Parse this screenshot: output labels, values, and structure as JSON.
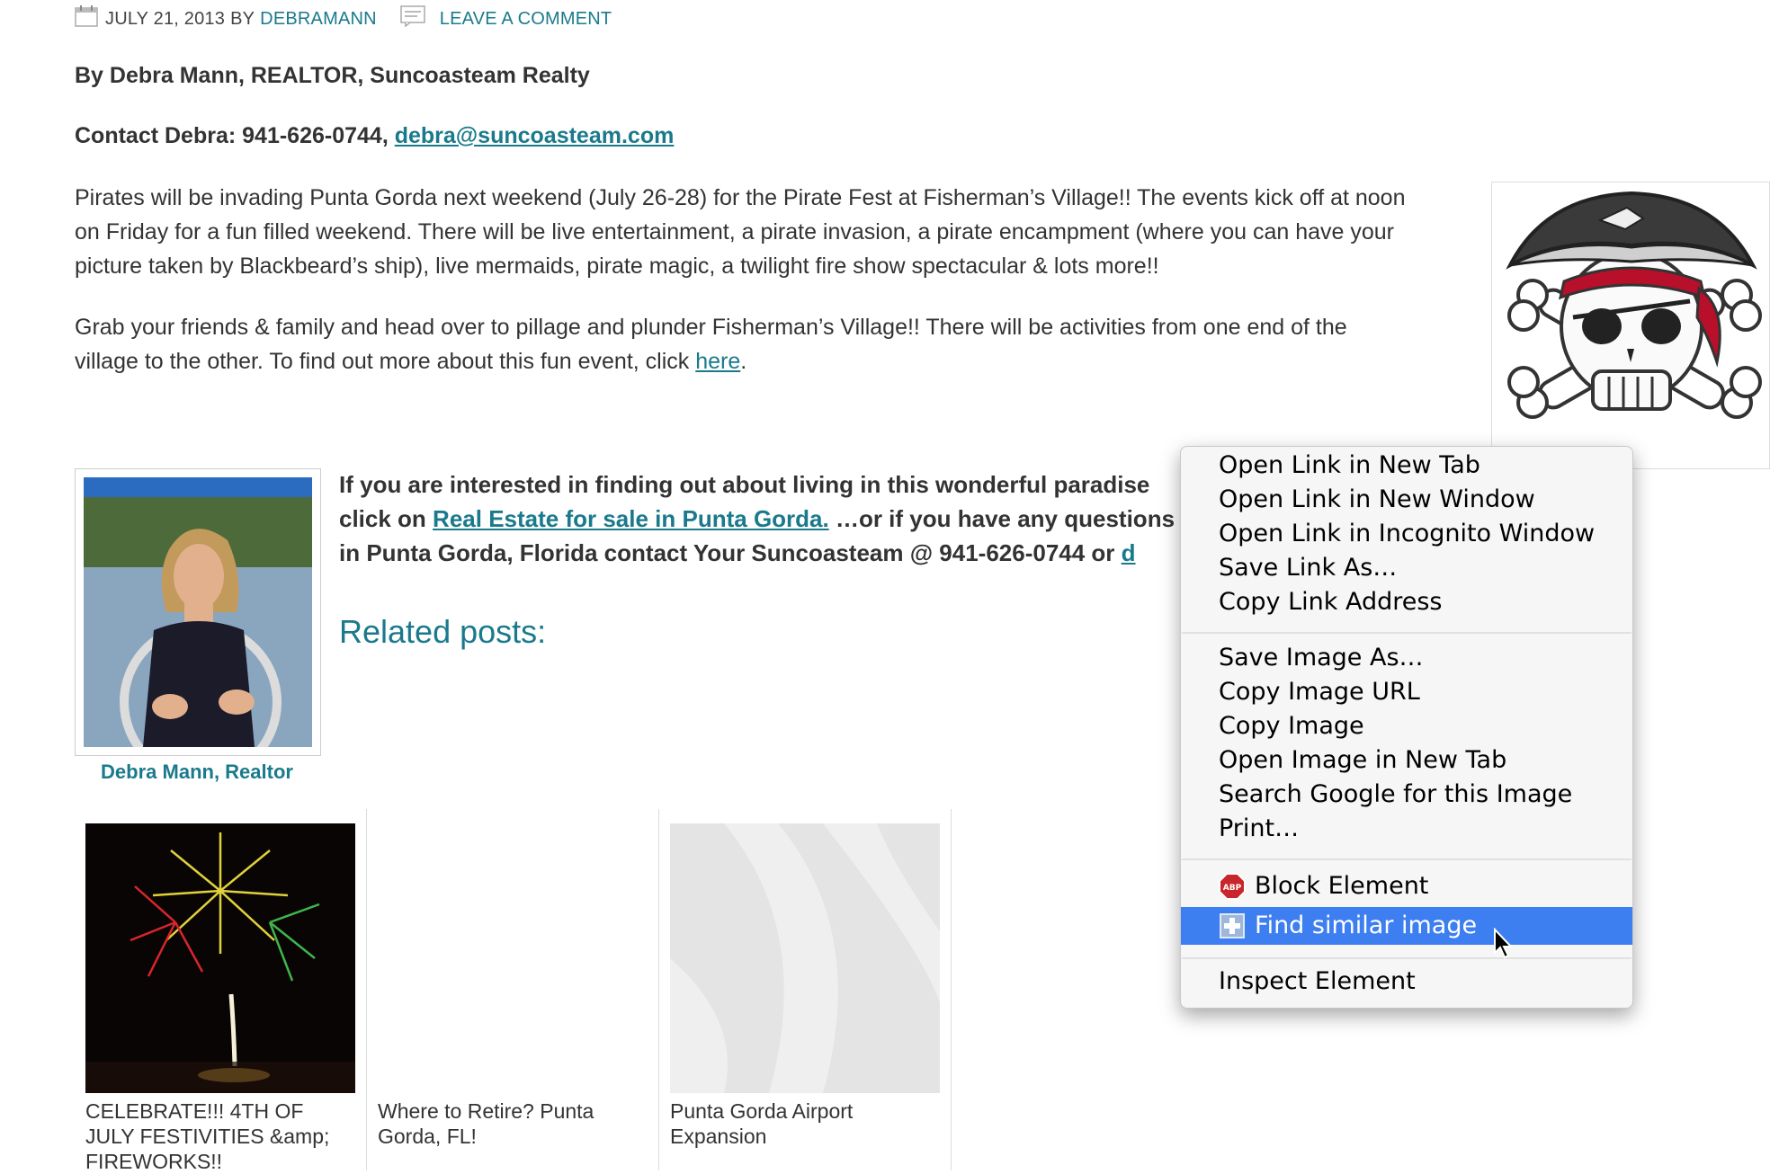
{
  "post_meta": {
    "date": "JULY 21, 2013",
    "by": "BY",
    "author": "DEBRAMANN",
    "comment_link": "LEAVE A COMMENT"
  },
  "byline": "By Debra Mann, REALTOR, Suncoasteam Realty",
  "contact": {
    "prefix": "Contact Debra: 941-626-0744, ",
    "email": "debra@suncoasteam.com"
  },
  "paragraphs": {
    "p1_line1": "Pirates will be invading Punta Gorda next weekend (July 26-28) for the Pirate Fest at Fisherman’s Village!!  The events kick off at noon",
    "p1_line2": "on Friday for a fun filled weekend.  There will be live entertainment, a pirate invasion, a pirate encampment (where you can have your",
    "p1_line3": "picture taken by Blackbeard’s ship), live mermaids, pirate magic, a twilight fire show spectacular & lots more!!",
    "p2_line1": "Grab your friends & family and head over to pillage and plunder Fisherman’s Village!!  There will be activities from one end of the",
    "p2_line2_prefix": "village to the other.  To find out more about this fun event, click ",
    "p2_link": "here",
    "p2_suffix": "."
  },
  "interest": {
    "line1": "If you are interested in finding out about living in this wonderful paradise",
    "line2_prefix": "click on ",
    "line2_link": "Real Estate for sale in Punta Gorda.",
    "line2_suffix": "  …or if you have any questions about real estate",
    "line3": "in Punta Gorda, Florida contact Your Suncoasteam @ 941-626-0744 or ",
    "line3_link": "d"
  },
  "author_caption": "Debra Mann, Realtor",
  "related_heading": "Related posts:",
  "related_posts": [
    {
      "title": "CELEBRATE!!! 4TH OF JULY FESTIVITIES &amp; FIREWORKS!!"
    },
    {
      "title": "Where to Retire? Punta Gorda, FL!"
    },
    {
      "title": "Punta Gorda Airport Expansion"
    }
  ],
  "context_menu": {
    "items": [
      "Open Link in New Tab",
      "Open Link in New Window",
      "Open Link in Incognito Window",
      "Save Link As…",
      "Copy Link Address",
      "Save Image As…",
      "Copy Image URL",
      "Copy Image",
      "Open Image in New Tab",
      "Search Google for this Image",
      "Print…",
      "Block Element",
      "Find similar image",
      "Inspect Element"
    ],
    "abp_badge": "ABP",
    "highlight_color": "#3d7ef0"
  },
  "icons": [
    "calendar-icon",
    "comment-icon",
    "adblock-icon",
    "extension-icon",
    "mouse-cursor-icon"
  ]
}
